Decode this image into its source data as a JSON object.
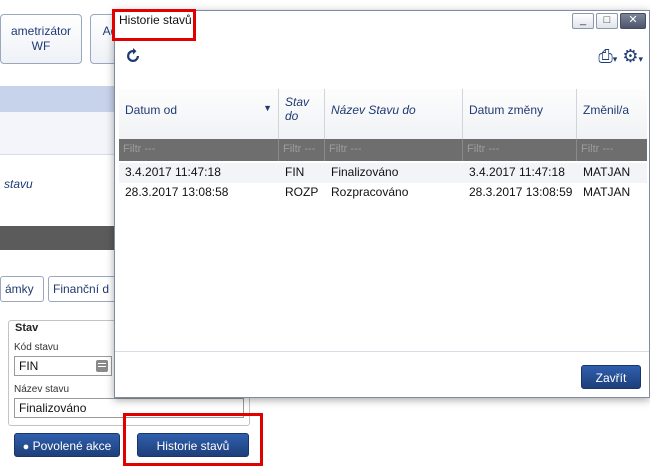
{
  "background": {
    "tabs": [
      {
        "label": "ametrizátor WF"
      },
      {
        "label": "Ad"
      }
    ],
    "section_label": "stavu",
    "subtabs": [
      {
        "label": "ámky"
      },
      {
        "label": "Finanční d"
      }
    ],
    "fieldset": {
      "legend": "Stav",
      "kod_label": "Kód stavu",
      "kod_value": "FIN",
      "nazev_label": "Název stavu",
      "nazev_value": "Finalizováno"
    },
    "buttons": {
      "povolene": "Povolené akce",
      "historie": "Historie stavů"
    }
  },
  "modal": {
    "title": "Historie stavů",
    "window_buttons": [
      "_",
      "□",
      "X"
    ],
    "toolbar": {
      "refresh_icon": "refresh-icon",
      "print_icon": "printer-icon",
      "settings_icon": "gear-icon"
    },
    "columns": [
      "Datum od",
      "Stav do",
      "Název Stavu do",
      "Datum změny",
      "Změnil/a"
    ],
    "filter_placeholder": "Filtr ---",
    "rows": [
      [
        "3.4.2017 11:47:18",
        "FIN",
        "Finalizováno",
        "3.4.2017 11:47:18",
        "MATJAN"
      ],
      [
        "28.3.2017 13:08:58",
        "ROZP",
        "Rozpracováno",
        "28.3.2017 13:08:59",
        "MATJAN"
      ]
    ],
    "close_button": "Zavřít"
  },
  "colors": {
    "accent_blue": "#1f3b73",
    "button_blue": "#2f5fad",
    "highlight_red": "#e00000",
    "filter_gray": "#6e6e6e"
  }
}
